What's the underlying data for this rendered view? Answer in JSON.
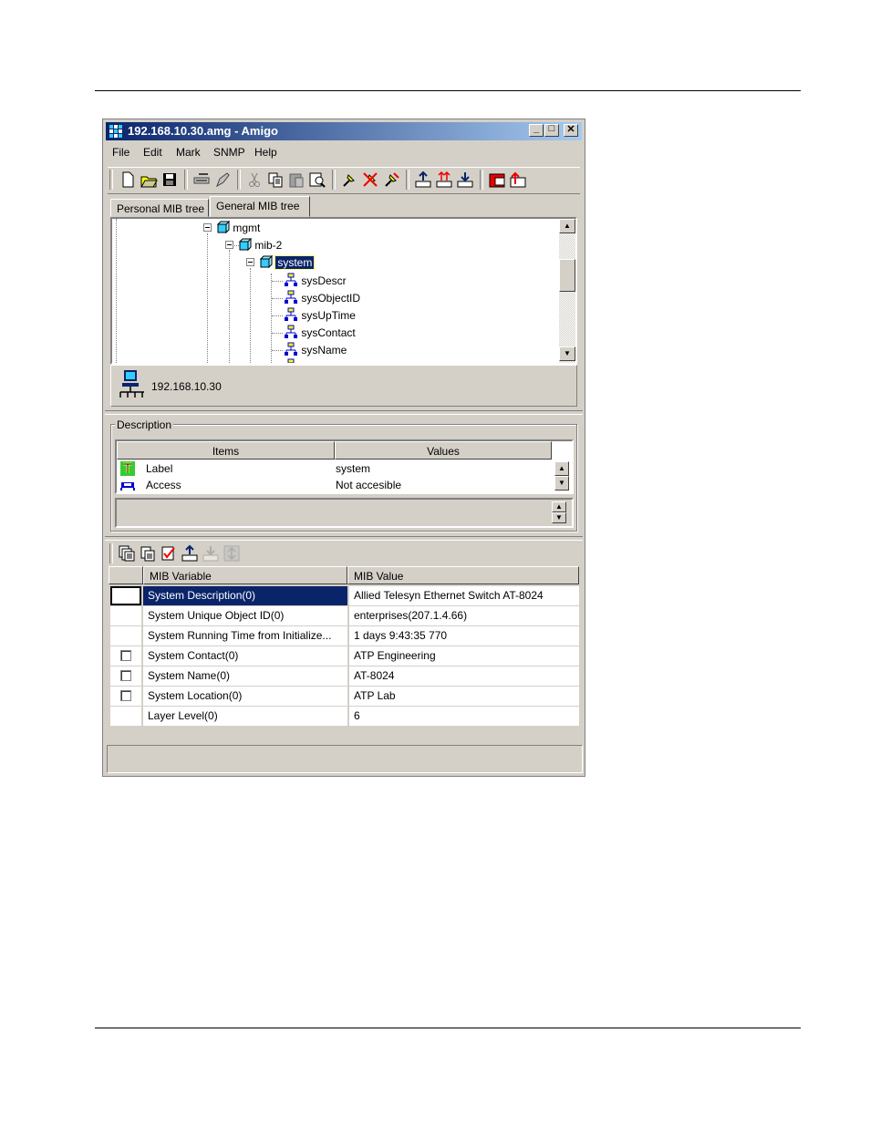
{
  "window": {
    "title": "192.168.10.30.amg - Amigo",
    "controls": [
      "_",
      "□",
      "✕"
    ]
  },
  "menubar": [
    "File",
    "Edit",
    "Mark",
    "SNMP",
    "Help"
  ],
  "toolbar_icons": [
    "new-icon",
    "open-icon",
    "save-icon",
    "connect-icon",
    "edit-icon",
    "cut-icon",
    "copy-icon",
    "paste-icon",
    "find-icon",
    "mark-icon",
    "unmark-icon",
    "mark-all-icon",
    "get-icon",
    "get-next-icon",
    "walk-icon",
    "set-icon",
    "trap-icon"
  ],
  "tabs": {
    "personal": "Personal MIB tree",
    "general": "General MIB tree"
  },
  "tree": {
    "nodes": [
      {
        "label": "mgmt"
      },
      {
        "label": "mib-2"
      },
      {
        "label": "system",
        "selected": true
      },
      {
        "label": "sysDescr"
      },
      {
        "label": "sysObjectID"
      },
      {
        "label": "sysUpTime"
      },
      {
        "label": "sysContact"
      },
      {
        "label": "sysName"
      }
    ],
    "host": "192.168.10.30"
  },
  "description": {
    "legend": "Description",
    "columns": [
      "Items",
      "Values"
    ],
    "rows": [
      {
        "item": "Label",
        "value": "system"
      },
      {
        "item": "Access",
        "value": "Not accesible"
      }
    ]
  },
  "results_toolbar_icons": [
    "get-all-icon",
    "get-marked-icon",
    "check-icon",
    "get-icon",
    "set-disabled-icon",
    "trap-disabled-icon"
  ],
  "variables": {
    "columns": [
      "MIB Variable",
      "MIB Value"
    ],
    "rows": [
      {
        "name": "System Description(0)",
        "value": "Allied Telesyn Ethernet Switch AT-8024",
        "selected": true,
        "checkbox": false
      },
      {
        "name": "System Unique Object ID(0)",
        "value": "enterprises(207.1.4.66)",
        "checkbox": false
      },
      {
        "name": "System Running Time from Initialize...",
        "value": "1 days 9:43:35 770",
        "checkbox": false
      },
      {
        "name": "System Contact(0)",
        "value": "ATP Engineering",
        "checkbox": true
      },
      {
        "name": "System Name(0)",
        "value": "AT-8024",
        "checkbox": true
      },
      {
        "name": "System Location(0)",
        "value": "ATP Lab",
        "checkbox": true
      },
      {
        "name": "Layer Level(0)",
        "value": "6",
        "checkbox": false
      }
    ]
  },
  "colors": {
    "titlebar_start": "#0a246a",
    "titlebar_end": "#a6caf0",
    "selection": "#0a246a",
    "face": "#d4d0c8"
  }
}
